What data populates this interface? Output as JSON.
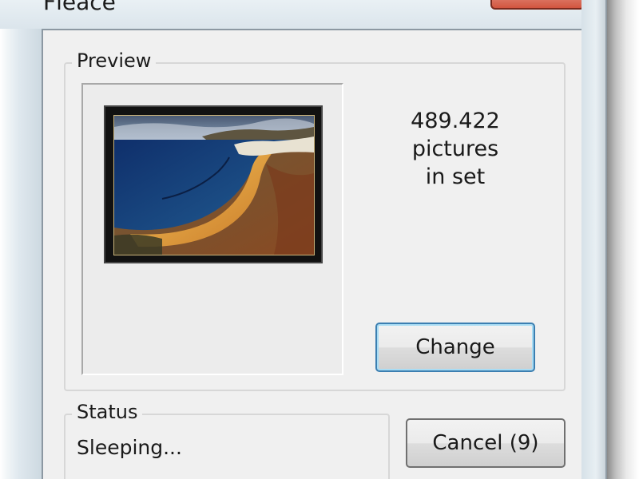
{
  "window": {
    "title": "Fleace"
  },
  "preview": {
    "group_label": "Preview",
    "count_value": "489.422",
    "count_line2": "pictures",
    "count_line3": "in set",
    "change_label": "Change"
  },
  "status": {
    "group_label": "Status",
    "text": "Sleeping...",
    "cancel_label": "Cancel (9)"
  },
  "colors": {
    "close_button": "#d2553f",
    "focus_border": "#3c7fb1",
    "dialog_bg": "#f0f0f0"
  },
  "icons": {
    "preview_image": "beach-landscape-thumbnail"
  }
}
